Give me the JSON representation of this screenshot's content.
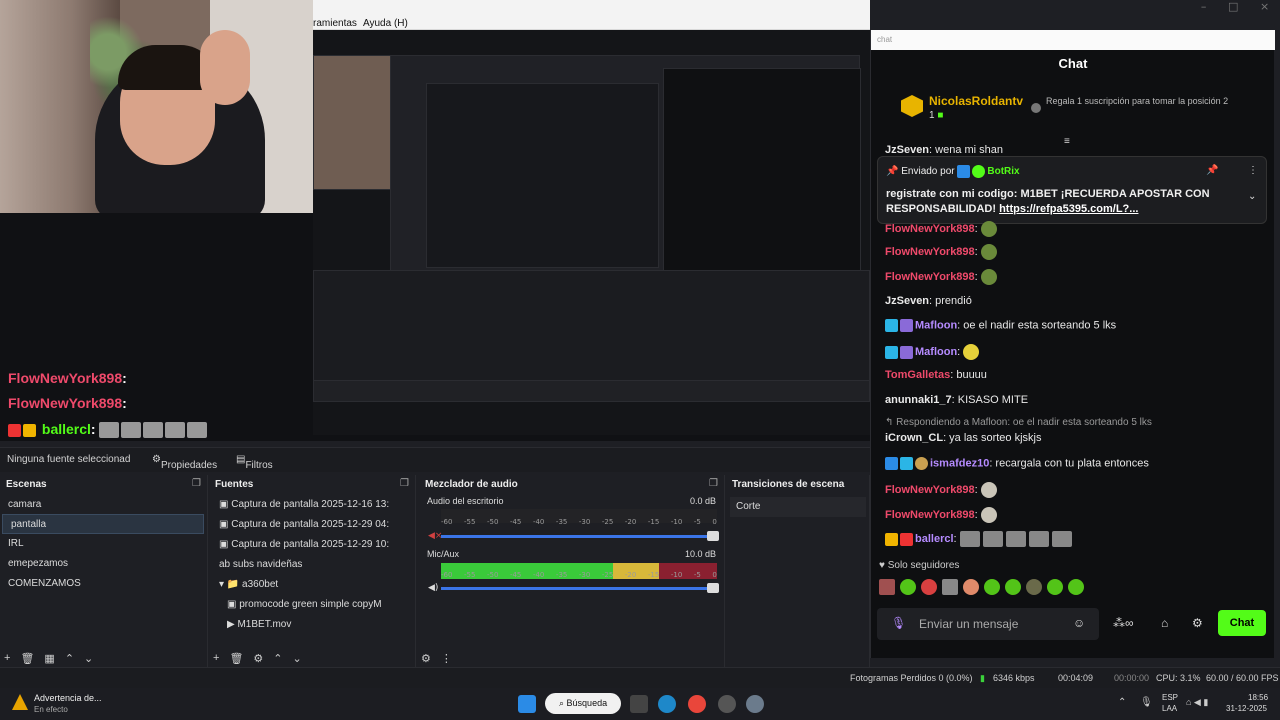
{
  "menu": {
    "item1": "ramientas",
    "item2": "Ayuda (H)"
  },
  "window_controls": [
    "–",
    "□",
    "×"
  ],
  "overlay_chat": [
    {
      "user": "FlowNewYork898",
      "text": ":"
    },
    {
      "user": "FlowNewYork898",
      "text": ":"
    },
    {
      "user": "ballercl",
      "text": ":"
    }
  ],
  "source_bar": {
    "no_source": "Ninguna fuente seleccionad",
    "properties": "Propiedades",
    "filters": "Filtros"
  },
  "scenes": {
    "title": "Escenas",
    "items": [
      "camara",
      "pantalla",
      "IRL",
      "emepezamos",
      "COMENZAMOS"
    ],
    "selected": "pantalla"
  },
  "sources": {
    "title": "Fuentes",
    "items": [
      "Captura de pantalla 2025-12-16 13:",
      "Captura de pantalla 2025-12-29 04:",
      "Captura de pantalla 2025-12-29 10:",
      "subs navideñas",
      "a360bet",
      "promocode green simple copyM",
      "M1BET.mov"
    ]
  },
  "mixer": {
    "title": "Mezclador de audio",
    "channels": [
      {
        "name": "Audio del escritorio",
        "db": "0.0 dB"
      },
      {
        "name": "Mic/Aux",
        "db": "10.0 dB"
      }
    ],
    "scale": [
      "-60",
      "-55",
      "-50",
      "-45",
      "-40",
      "-35",
      "-30",
      "-25",
      "-20",
      "-15",
      "-10",
      "-5",
      "0"
    ]
  },
  "transitions": {
    "title": "Transiciones de escena",
    "current": "Corte"
  },
  "status": {
    "dropped": "Fotogramas Perdidos 0 (0.0%)",
    "kbps": "6346 kbps",
    "time1": "00:04:09",
    "time2": "00:00:00",
    "cpu": "CPU: 3.1%",
    "fps": "60.00 / 60.00 FPS"
  },
  "taskbar": {
    "notification_title": "Advertencia de...",
    "notification_sub": "En efecto",
    "search": "Búsqueda",
    "lang1": "ESP",
    "lang2": "LAA",
    "clock": "18:56",
    "date": "31-12-2025"
  },
  "chat": {
    "input_hint": "chat",
    "title": "Chat",
    "top_gifter": "NicolasRoldantv",
    "top_gifter_count": "1",
    "gift_prompt": "Regala 1 suscripción para tomar la posición 2",
    "pinned_sender_label": "Enviado por",
    "pinned_sender": "BotRix",
    "pinned_text": "registrate con mi codigo: M1BET ¡RECUERDA APOSTAR CON RESPONSABILIDAD!",
    "pinned_link": "https://refpa5395.com/L?...",
    "partial_top": {
      "user": "JzSeven",
      "text": "wena mi shan"
    },
    "messages": [
      {
        "user": "FlowNewYork898",
        "text": ":",
        "color": "pink"
      },
      {
        "user": "FlowNewYork898",
        "text": ":",
        "color": "pink"
      },
      {
        "user": "FlowNewYork898",
        "text": ":",
        "color": "pink"
      },
      {
        "user": "JzSeven",
        "text": ": prendió",
        "color": "white"
      },
      {
        "user": "Mafloon",
        "text": ": oe el nadir esta sorteando 5 lks",
        "color": "purple"
      },
      {
        "user": "Mafloon",
        "text": ":",
        "color": "purple"
      },
      {
        "user": "TomGalletas",
        "text": ": buuuu",
        "color": "pink"
      },
      {
        "user": "anunnaki1_7",
        "text": ": KISASO MITE",
        "color": "white"
      },
      {
        "user": "iCrown_CL",
        "text": ": ya las sorteo kjskjs",
        "color": "white",
        "reply": "Respondiendo a Mafloon: oe el nadir esta sorteando 5 lks"
      },
      {
        "user": "ismafdez10",
        "text": ": recargala con tu plata entonces",
        "color": "purple"
      },
      {
        "user": "FlowNewYork898",
        "text": ":",
        "color": "pink"
      },
      {
        "user": "FlowNewYork898",
        "text": ":",
        "color": "pink"
      },
      {
        "user": "ballercl",
        "text": ":",
        "color": "purple"
      }
    ],
    "followers_only": "Solo seguidores",
    "composer_placeholder": "Enviar un mensaje",
    "send_label": "Chat"
  },
  "colors": {
    "kick_green": "#53fc18",
    "pink": "#ef4a6b",
    "purple": "#b58bff"
  }
}
